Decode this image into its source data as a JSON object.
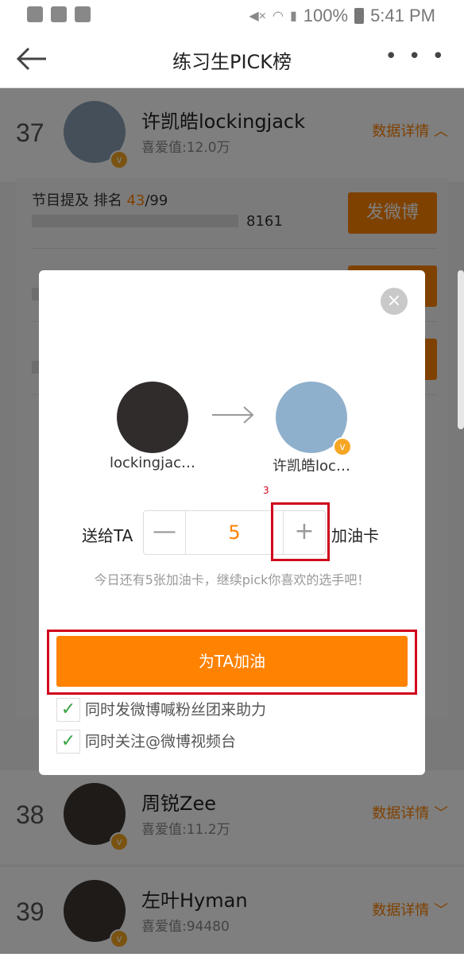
{
  "statusbar": {
    "battery": "100%",
    "time": "5:41 PM"
  },
  "header": {
    "title": "练习生PICK榜",
    "more": "• • •"
  },
  "list": [
    {
      "rank": "37",
      "name": "许凯皓lockingjack",
      "love": "喜爱值:12.0万",
      "detail": "数据详情 ︿"
    },
    {
      "rank": "38",
      "name": "周锐Zee",
      "love": "喜爱值:11.2万",
      "detail": "数据详情 ﹀"
    },
    {
      "rank": "39",
      "name": "左叶Hyman",
      "love": "喜爱值:94480",
      "detail": "数据详情 ﹀"
    }
  ],
  "details": {
    "row1": {
      "label_prefix": "节目提及 排名 ",
      "rank": "43",
      "total": "/99",
      "value": "8161",
      "button": "发微博"
    }
  },
  "modal": {
    "close": "×",
    "from_name": "lockingjac…",
    "to_name": "许凯皓loc…",
    "give_label": "送给TA",
    "minus": "—",
    "quantity": "5",
    "plus": "+",
    "card_label": "加油卡",
    "hint": "今日还有5张加油卡，继续pick你喜欢的选手吧！",
    "cheer_button": "为TA加油",
    "options": [
      {
        "label": "同时发微博喊粉丝团来助力",
        "checked": true
      },
      {
        "label": "同时关注@微博视频台",
        "checked": true
      }
    ],
    "annotation": "3"
  },
  "icons": {
    "back": "back-arrow-icon",
    "close": "close-icon",
    "check": "check-icon",
    "verified": "verified-badge-icon",
    "arrow_right": "arrow-right-icon"
  },
  "colors": {
    "accent": "#ff8200",
    "highlight_box": "#d0021b",
    "check": "#3aa245"
  }
}
